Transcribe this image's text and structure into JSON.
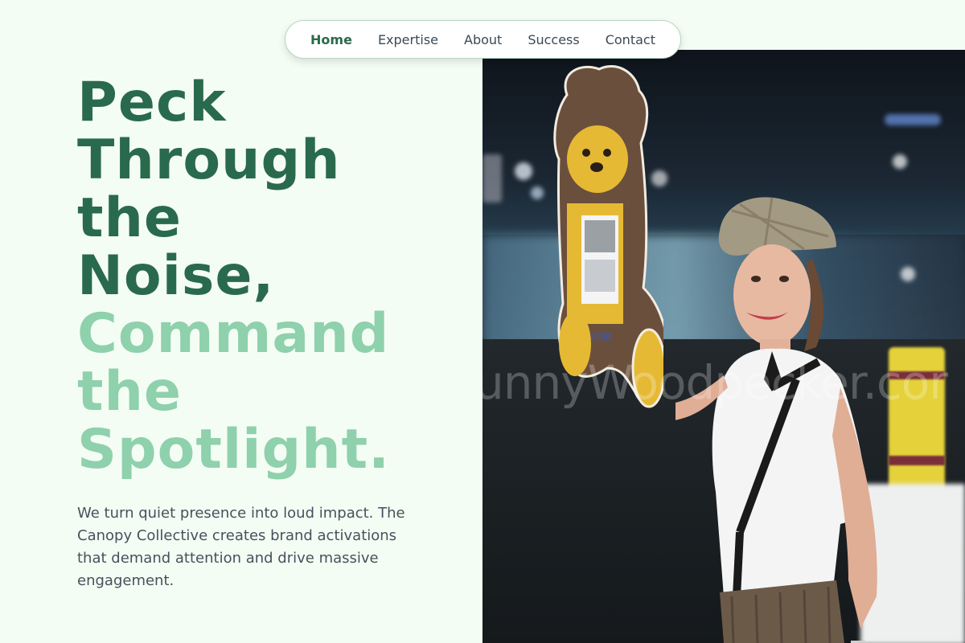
{
  "nav": {
    "items": [
      {
        "label": "Home",
        "active": true
      },
      {
        "label": "Expertise",
        "active": false
      },
      {
        "label": "About",
        "active": false
      },
      {
        "label": "Success",
        "active": false
      },
      {
        "label": "Contact",
        "active": false
      }
    ]
  },
  "hero": {
    "headline_dark": [
      "Peck",
      "Through",
      "the",
      "Noise,"
    ],
    "headline_light": [
      "Command",
      "the",
      "Spotlight."
    ],
    "lede": "We turn quiet presence into loud impact. The Canopy Collective creates brand activations that demand attention and drive massive engagement.",
    "image_watermark": "unnyWoodpecker.cor"
  },
  "colors": {
    "background": "#f4fdf4",
    "headline_dark": "#2a6a4c",
    "headline_light": "#8ed1ac",
    "body_text": "#45525c"
  }
}
